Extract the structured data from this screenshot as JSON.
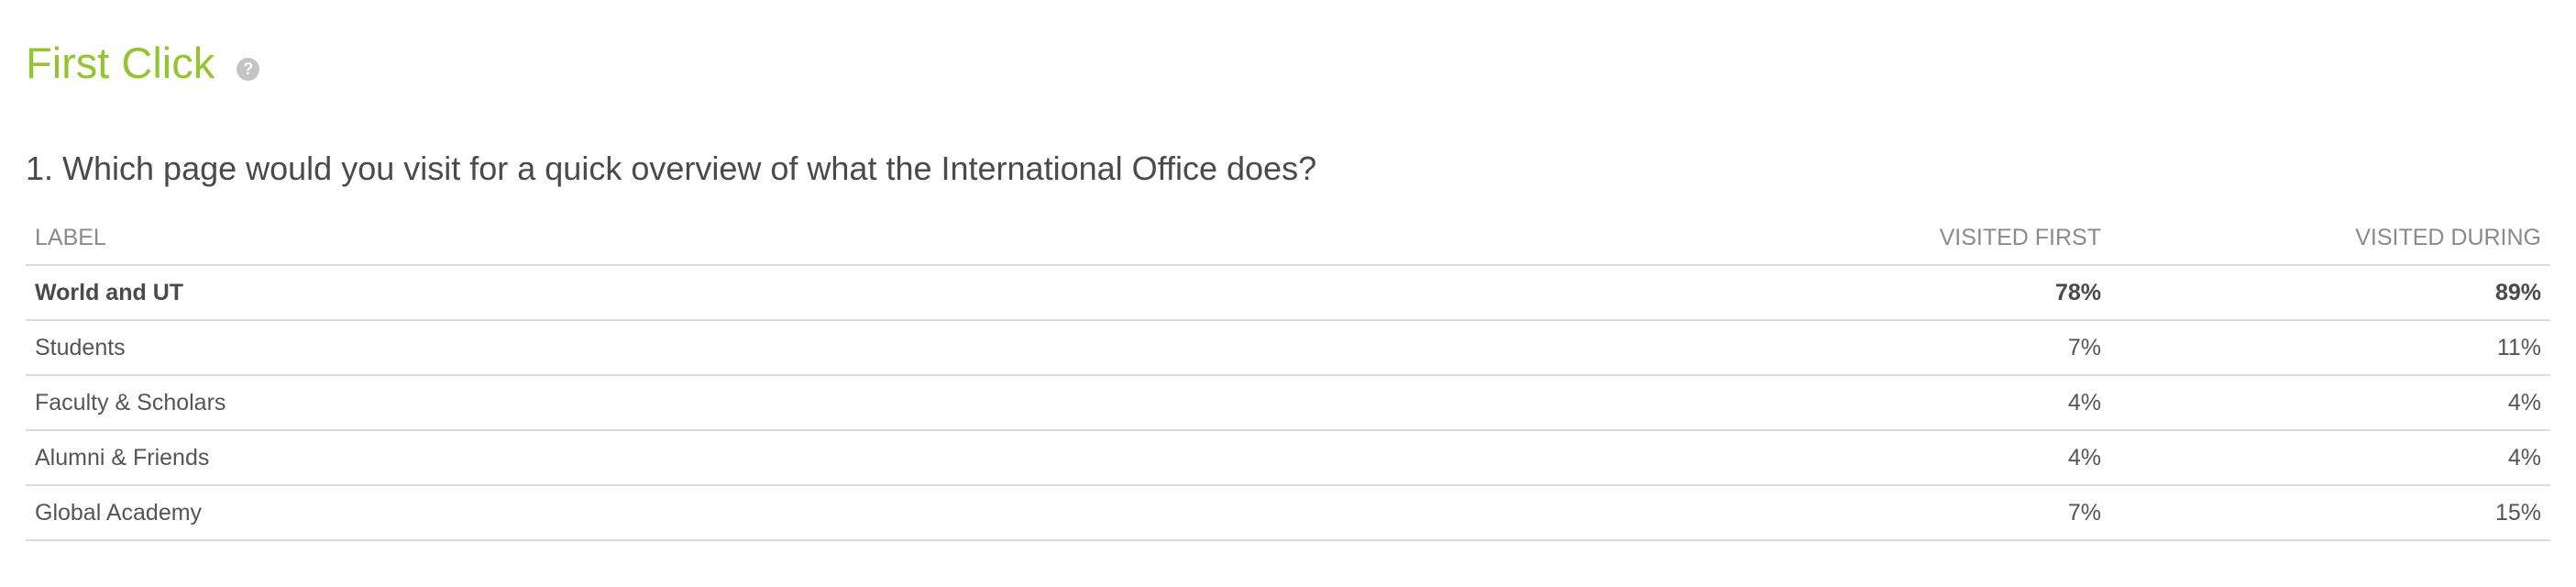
{
  "header": {
    "title": "First Click",
    "help_icon": "question-circle-icon",
    "help_glyph": "?"
  },
  "question": {
    "text": "1. Which page would you visit for a quick overview of what the International Office does?"
  },
  "table": {
    "columns": {
      "label": "LABEL",
      "visited_first": "VISITED FIRST",
      "visited_during": "VISITED DURING"
    },
    "rows": [
      {
        "label": "World and UT",
        "visited_first": "78%",
        "visited_during": "89%",
        "bold": true
      },
      {
        "label": "Students",
        "visited_first": "7%",
        "visited_during": "11%"
      },
      {
        "label": "Faculty & Scholars",
        "visited_first": "4%",
        "visited_during": "4%"
      },
      {
        "label": "Alumni & Friends",
        "visited_first": "4%",
        "visited_during": "4%"
      },
      {
        "label": "Global Academy",
        "visited_first": "7%",
        "visited_during": "15%"
      }
    ]
  },
  "colors": {
    "title_accent": "#95c433",
    "text": "#4a4a4a",
    "header_text": "#8a8a8a",
    "divider": "#dcdcdc"
  }
}
